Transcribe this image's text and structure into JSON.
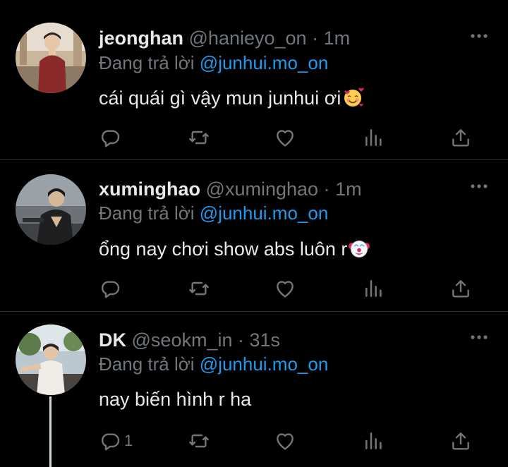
{
  "tweets": [
    {
      "display_name": "jeonghan",
      "handle": "@hanieyo_on",
      "separator": "·",
      "time": "1m",
      "reply_prefix": "Đang trả lời",
      "reply_to": "@junhui.mo_on",
      "text": "cái quái gì vậy mun junhui ơi",
      "emoji": "smiling-face-with-hearts",
      "reply_count": ""
    },
    {
      "display_name": "xuminghao",
      "handle": "@xuminghao",
      "separator": "·",
      "time": "1m",
      "reply_prefix": "Đang trả lời",
      "reply_to": "@junhui.mo_on",
      "text": "ổng nay chơi show abs luôn r",
      "emoji": "clown-face",
      "reply_count": ""
    },
    {
      "display_name": "DK",
      "handle": "@seokm_in",
      "separator": "·",
      "time": "31s",
      "reply_prefix": "Đang trả lời",
      "reply_to": "@junhui.mo_on",
      "text": "nay biến hình r ha",
      "emoji": "",
      "reply_count": "1"
    }
  ],
  "colors": {
    "background": "#000000",
    "primary_text": "#e7e9ea",
    "secondary_text": "#71767b",
    "mention": "#1d9bf0",
    "divider": "#2f3336"
  },
  "icons": [
    "avatar",
    "more-icon",
    "reply-icon",
    "retweet-icon",
    "like-icon",
    "views-icon",
    "share-icon"
  ]
}
